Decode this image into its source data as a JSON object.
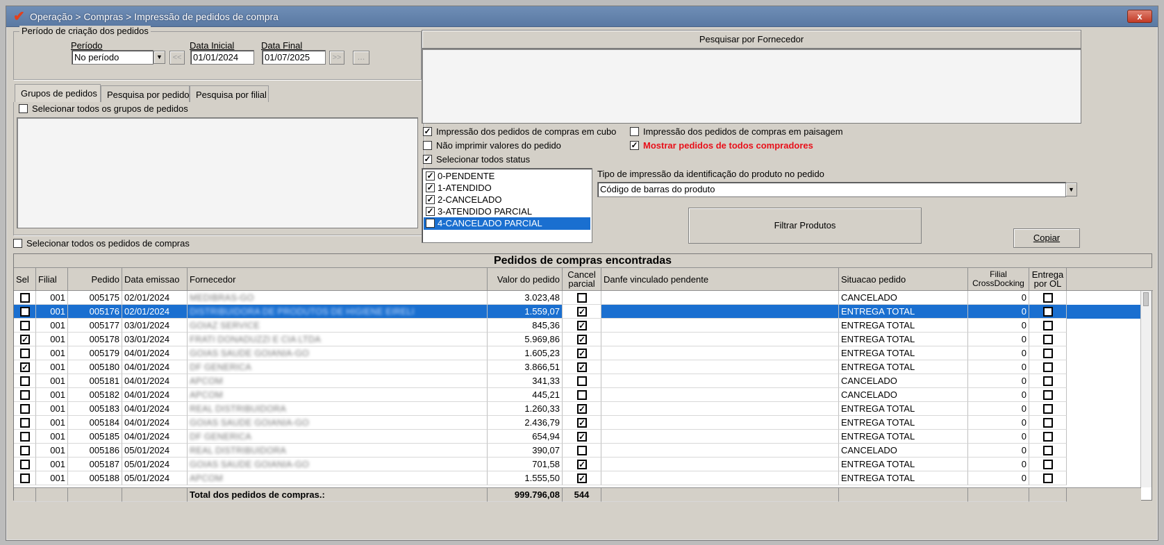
{
  "window": {
    "title": "Operação > Compras > Impressão de pedidos de compra",
    "close_label": "x"
  },
  "periodo": {
    "group_title": "Período de criação dos pedidos",
    "periodo_label": "Período",
    "periodo_value": "No período",
    "data_inicial_label": "Data Inicial",
    "data_inicial_value": "01/01/2024",
    "data_final_label": "Data Final",
    "data_final_value": "01/07/2025",
    "prev_label": "<<",
    "next_label": ">>",
    "more_label": "..."
  },
  "tabs": [
    "Grupos de pedidos",
    "Pesquisa por pedido",
    "Pesquisa por filial"
  ],
  "grupos": {
    "select_all_label": "Selecionar todos os grupos de pedidos"
  },
  "select_all_pedidos_label": "Selecionar todos os pedidos de compras",
  "fornecedor": {
    "header": "Pesquisar por Fornecedor"
  },
  "options": {
    "cubo": {
      "label": "Impressão dos pedidos de compras em cubo",
      "checked": true
    },
    "paisagem": {
      "label": "Impressão dos pedidos de compras em paisagem",
      "checked": false
    },
    "nao_imprimir": {
      "label": "Não imprimir valores do pedido",
      "checked": false
    },
    "mostrar_todos": {
      "label": "Mostrar pedidos de todos compradores",
      "checked": true
    },
    "todos_status": {
      "label": "Selecionar todos status",
      "checked": true
    }
  },
  "status_list": [
    {
      "label": "0-PENDENTE",
      "checked": true
    },
    {
      "label": "1-ATENDIDO",
      "checked": true
    },
    {
      "label": "2-CANCELADO",
      "checked": true
    },
    {
      "label": "3-ATENDIDO PARCIAL",
      "checked": true
    },
    {
      "label": "4-CANCELADO PARCIAL",
      "checked": true
    }
  ],
  "tipo_impressao": {
    "label": "Tipo de impressão da identificação do produto no pedido",
    "value": "Código de barras do produto"
  },
  "filtrar_label": "Filtrar Produtos",
  "copiar_label": "Copiar",
  "grid": {
    "title": "Pedidos de compras encontradas",
    "headers": {
      "sel": "Sel",
      "filial": "Filial",
      "pedido": "Pedido",
      "data": "Data emissao",
      "fornecedor": "Fornecedor",
      "valor": "Valor do pedido",
      "cancel": "Cancel parcial",
      "danfe": "Danfe vinculado pendente",
      "situacao": "Situacao pedido",
      "crossdocking": "Filial CrossDocking",
      "entrega": "Entrega por OL"
    },
    "rows": [
      {
        "sel": false,
        "filial": "001",
        "pedido": "005175",
        "data": "02/01/2024",
        "fornecedor": "MEDIBRAS-GO",
        "valor": "3.023,48",
        "cancel": false,
        "situacao": "CANCELADO",
        "crossdocking": "0",
        "entrega": false
      },
      {
        "sel": false,
        "filial": "001",
        "pedido": "005176",
        "data": "02/01/2024",
        "fornecedor": "DISTRIBUIDORA DE PRODUTOS DE HIGIENE EIRELI",
        "valor": "1.559,07",
        "cancel": true,
        "situacao": "ENTREGA TOTAL",
        "crossdocking": "0",
        "entrega": false
      },
      {
        "sel": false,
        "filial": "001",
        "pedido": "005177",
        "data": "03/01/2024",
        "fornecedor": "GOIAZ SERVICE",
        "valor": "845,36",
        "cancel": true,
        "situacao": "ENTREGA TOTAL",
        "crossdocking": "0",
        "entrega": false
      },
      {
        "sel": true,
        "filial": "001",
        "pedido": "005178",
        "data": "03/01/2024",
        "fornecedor": "FRATI DONADUZZI E CIA LTDA",
        "valor": "5.969,86",
        "cancel": true,
        "situacao": "ENTREGA TOTAL",
        "crossdocking": "0",
        "entrega": false
      },
      {
        "sel": false,
        "filial": "001",
        "pedido": "005179",
        "data": "04/01/2024",
        "fornecedor": "GOIAS SAUDE GOIANIA-GO",
        "valor": "1.605,23",
        "cancel": true,
        "situacao": "ENTREGA TOTAL",
        "crossdocking": "0",
        "entrega": false
      },
      {
        "sel": true,
        "filial": "001",
        "pedido": "005180",
        "data": "04/01/2024",
        "fornecedor": "DF GENERICA",
        "valor": "3.866,51",
        "cancel": true,
        "situacao": "ENTREGA TOTAL",
        "crossdocking": "0",
        "entrega": false
      },
      {
        "sel": false,
        "filial": "001",
        "pedido": "005181",
        "data": "04/01/2024",
        "fornecedor": "APCOM",
        "valor": "341,33",
        "cancel": false,
        "situacao": "CANCELADO",
        "crossdocking": "0",
        "entrega": false
      },
      {
        "sel": false,
        "filial": "001",
        "pedido": "005182",
        "data": "04/01/2024",
        "fornecedor": "APCOM",
        "valor": "445,21",
        "cancel": false,
        "situacao": "CANCELADO",
        "crossdocking": "0",
        "entrega": false
      },
      {
        "sel": false,
        "filial": "001",
        "pedido": "005183",
        "data": "04/01/2024",
        "fornecedor": "REAL DISTRIBUIDORA",
        "valor": "1.260,33",
        "cancel": true,
        "situacao": "ENTREGA TOTAL",
        "crossdocking": "0",
        "entrega": false
      },
      {
        "sel": false,
        "filial": "001",
        "pedido": "005184",
        "data": "04/01/2024",
        "fornecedor": "GOIAS SAUDE GOIANIA-GO",
        "valor": "2.436,79",
        "cancel": true,
        "situacao": "ENTREGA TOTAL",
        "crossdocking": "0",
        "entrega": false
      },
      {
        "sel": false,
        "filial": "001",
        "pedido": "005185",
        "data": "04/01/2024",
        "fornecedor": "DF GENERICA",
        "valor": "654,94",
        "cancel": true,
        "situacao": "ENTREGA TOTAL",
        "crossdocking": "0",
        "entrega": false
      },
      {
        "sel": false,
        "filial": "001",
        "pedido": "005186",
        "data": "05/01/2024",
        "fornecedor": "REAL DISTRIBUIDORA",
        "valor": "390,07",
        "cancel": false,
        "situacao": "CANCELADO",
        "crossdocking": "0",
        "entrega": false
      },
      {
        "sel": false,
        "filial": "001",
        "pedido": "005187",
        "data": "05/01/2024",
        "fornecedor": "GOIAS SAUDE GOIANIA-GO",
        "valor": "701,58",
        "cancel": true,
        "situacao": "ENTREGA TOTAL",
        "crossdocking": "0",
        "entrega": false
      },
      {
        "sel": false,
        "filial": "001",
        "pedido": "005188",
        "data": "05/01/2024",
        "fornecedor": "APCOM",
        "valor": "1.555,50",
        "cancel": true,
        "situacao": "ENTREGA TOTAL",
        "crossdocking": "0",
        "entrega": false
      }
    ],
    "selected_row": 1,
    "footer": {
      "label": "Total dos pedidos de compras.:",
      "total_valor": "999.796,08",
      "total_cancel": "544"
    }
  },
  "colors": {
    "title_bar": "#5f7fa8",
    "selection": "#1a6fd0",
    "highlight_text": "#e8101a"
  }
}
